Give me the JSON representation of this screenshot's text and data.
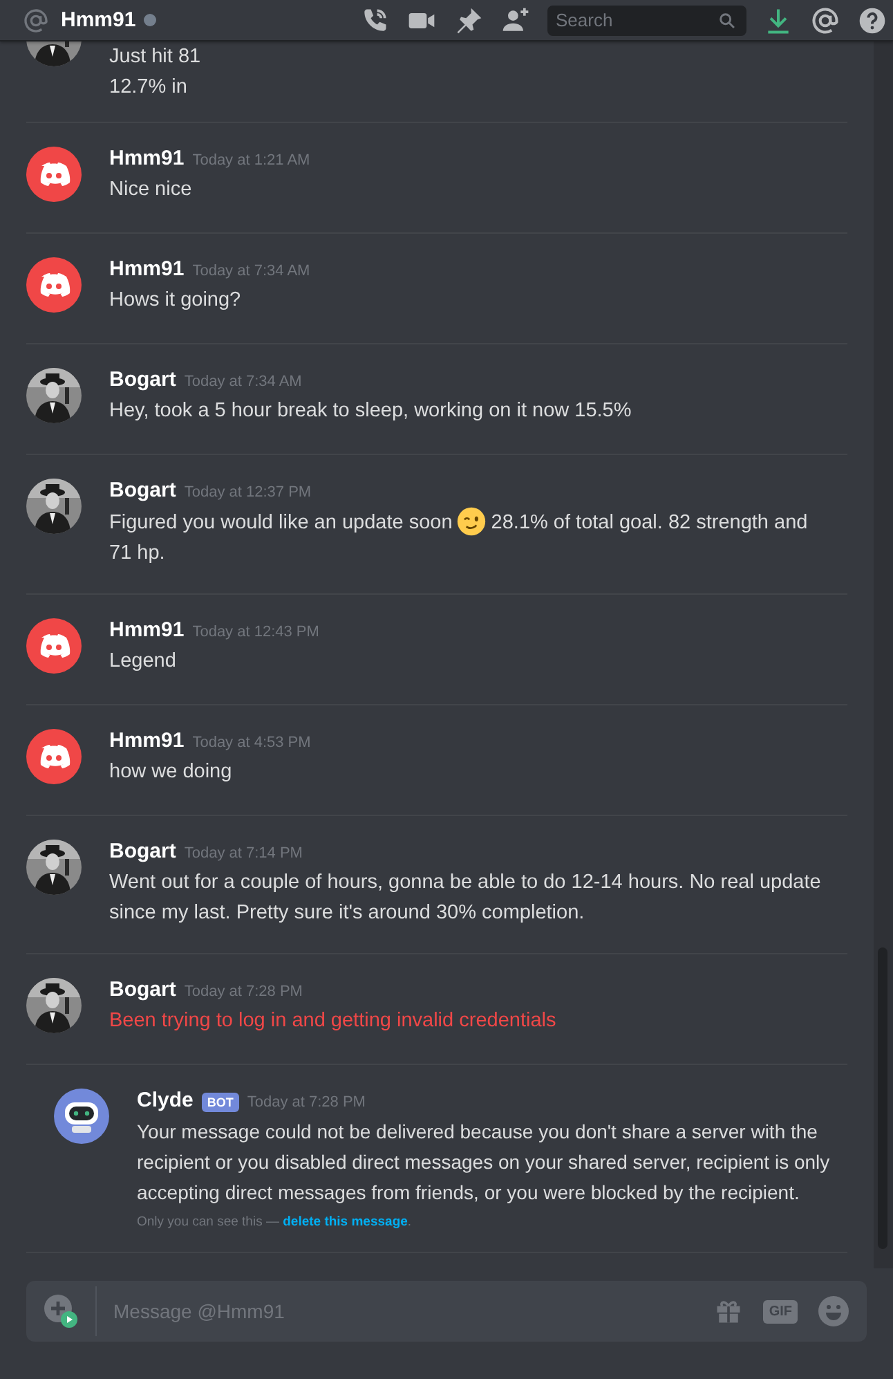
{
  "header": {
    "channel": "Hmm91",
    "online": false,
    "search": {
      "placeholder": "Search"
    }
  },
  "messages": [
    {
      "continued": true,
      "lines": [
        "Just hit 81",
        "12.7% in"
      ],
      "failed": false
    },
    {
      "kind": "discord",
      "continued": false,
      "author": "Hmm91",
      "time": "Today at 1:21 AM",
      "lines": [
        "Nice nice"
      ],
      "failed": false
    },
    {
      "kind": "discord",
      "continued": false,
      "author": "Hmm91",
      "time": "Today at 7:34 AM",
      "lines": [
        "Hows it going?"
      ],
      "failed": false
    },
    {
      "continued": false,
      "author": "Bogart",
      "time": "Today at 7:34 AM",
      "lines": [
        "Hey, took a 5 hour break to sleep, working on it now 15.5%"
      ],
      "failed": false
    },
    {
      "continued": false,
      "author": "Bogart",
      "time": "Today at 12:37 PM",
      "lines": [
        "Figured you would like an update soon",
        "71 hp."
      ],
      "emoji_text": "28.1% of total goal. 82 strength and",
      "failed": false
    },
    {
      "kind": "discord",
      "continued": false,
      "author": "Hmm91",
      "time": "Today at 12:43 PM",
      "lines": [
        "Legend"
      ],
      "failed": false
    },
    {
      "kind": "discord",
      "continued": false,
      "author": "Hmm91",
      "time": "Today at 4:53 PM",
      "lines": [
        "how we doing"
      ],
      "failed": false
    },
    {
      "continued": false,
      "author": "Bogart",
      "time": "Today at 7:14 PM",
      "lines": [
        "Went out for a couple of hours, gonna be able to do 12-14 hours. No real update since my last. Pretty sure it's around 30% completion."
      ],
      "failed": false
    },
    {
      "continued": false,
      "author": "Bogart",
      "time": "Today at 7:28 PM",
      "lines": [
        "Been trying to log in and getting invalid credentials"
      ],
      "failed": true
    }
  ],
  "system_message": {
    "author": "Clyde",
    "badge": "BOT",
    "time": "Today at 7:28 PM",
    "text": "Your message could not be delivered because you don't share a server with the recipient or you disabled direct messages on your shared server, recipient is only accepting direct messages from friends, or you were blocked by the recipient.",
    "note": "Only you can see this —",
    "link": "delete this message",
    "link_end": "."
  },
  "composer": {
    "placeholder": "Message @Hmm91",
    "gif": "GIF"
  }
}
